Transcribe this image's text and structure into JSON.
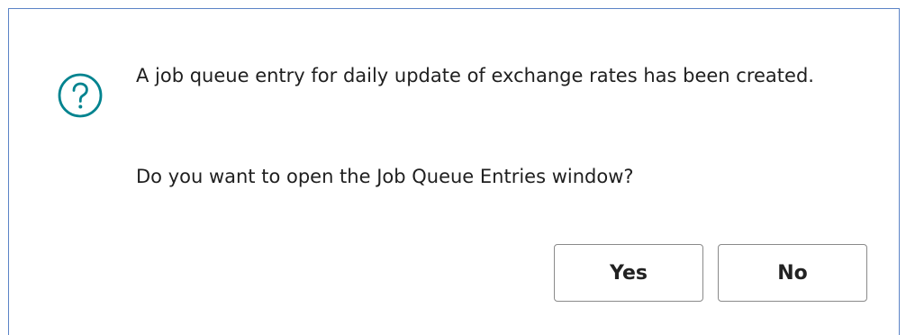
{
  "dialog": {
    "message_line1": "A job queue entry for daily update of exchange rates has been created.",
    "message_line2": "Do you want to open the Job Queue Entries window?",
    "icon": "question-circle-icon",
    "accent_color": "#00838f"
  },
  "buttons": {
    "yes_label": "Yes",
    "no_label": "No"
  }
}
